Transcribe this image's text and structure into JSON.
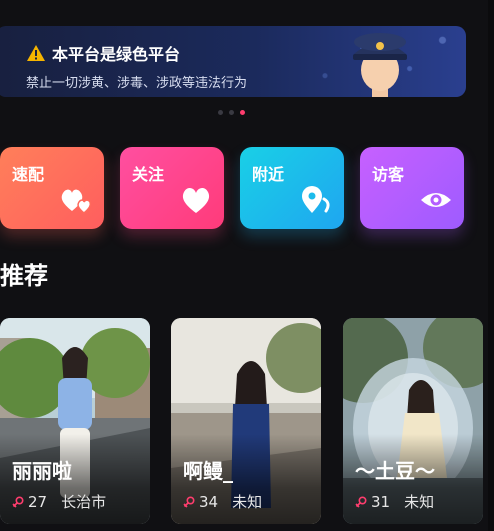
{
  "banner": {
    "title": "本平台是绿色平台",
    "subtitle": "禁止一切涉黄、涉毒、涉政等违法行为",
    "icon": "warning-icon",
    "illustration": "police-officer-illustration"
  },
  "carousel": {
    "dots": 3,
    "active_index": 2
  },
  "categories": [
    {
      "label": "速配",
      "icon": "hearts-icon",
      "color": "#ff6f5c"
    },
    {
      "label": "关注",
      "icon": "heart-icon",
      "color": "#ff4590"
    },
    {
      "label": "附近",
      "icon": "location-icon",
      "color": "#1cbbeb"
    },
    {
      "label": "访客",
      "icon": "eye-icon",
      "color": "#b45dff"
    }
  ],
  "section": {
    "title": "推荐"
  },
  "cards": [
    {
      "name": "丽丽啦",
      "age": "27",
      "location": "长治市"
    },
    {
      "name": "啊鳗_",
      "age": "34",
      "location": "未知"
    },
    {
      "name": "～土豆～",
      "age": "31",
      "location": "未知"
    }
  ],
  "colors": {
    "accent": "#ff3d6e",
    "background": "#101013"
  }
}
